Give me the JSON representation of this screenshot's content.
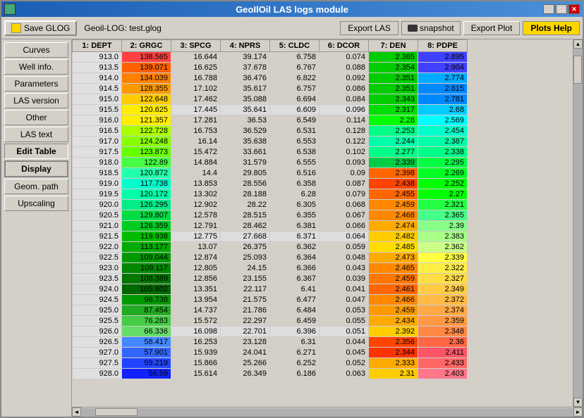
{
  "window": {
    "title": "GeoIlOil LAS logs module"
  },
  "toolbar": {
    "save_label": "Save GLOG",
    "file_label": "Geoil-LOG: test.glog",
    "export_las": "Export LAS",
    "snapshot": "snapshot",
    "export_plot": "Export Plot",
    "plots_help": "Plots Help"
  },
  "sidebar": {
    "buttons": [
      {
        "id": "curves",
        "label": "Curves"
      },
      {
        "id": "well-info",
        "label": "Well info."
      },
      {
        "id": "parameters",
        "label": "Parameters"
      },
      {
        "id": "las-version",
        "label": "LAS version"
      },
      {
        "id": "other",
        "label": "Other"
      },
      {
        "id": "las-text",
        "label": "LAS text"
      },
      {
        "id": "edit-table",
        "label": "Edit Table"
      },
      {
        "id": "display",
        "label": "Display"
      },
      {
        "id": "geom-path",
        "label": "Geom. path"
      },
      {
        "id": "upscaling",
        "label": "Upscaling"
      }
    ]
  },
  "table": {
    "columns": [
      {
        "id": "dept",
        "label": "1: DEPT"
      },
      {
        "id": "grgc",
        "label": "2: GRGC"
      },
      {
        "id": "spcg",
        "label": "3: SPCG"
      },
      {
        "id": "nprs",
        "label": "4: NPRS"
      },
      {
        "id": "cldc",
        "label": "5: CLDC"
      },
      {
        "id": "dcor",
        "label": "6: DCOR"
      },
      {
        "id": "den",
        "label": "7: DEN"
      },
      {
        "id": "pdpe",
        "label": "8: PDPE"
      }
    ],
    "rows": [
      {
        "dept": "913.0",
        "grgc": "138.565",
        "spcg": "16.644",
        "nprs": "39.174",
        "cldc": "6.758",
        "dcor": "0.074",
        "den": "2.365",
        "pdpe": "2.895",
        "grgc_color": "#ff4040",
        "den_color": "#00cc00",
        "pdpe_color": "#4040ff"
      },
      {
        "dept": "913.5",
        "grgc": "139.071",
        "spcg": "16.625",
        "nprs": "37.678",
        "cldc": "6.767",
        "dcor": "0.088",
        "den": "2.354",
        "pdpe": "2.904",
        "grgc_color": "#ff6000",
        "den_color": "#00cc00",
        "pdpe_color": "#4040ff"
      },
      {
        "dept": "914.0",
        "grgc": "134.039",
        "spcg": "16.788",
        "nprs": "36.476",
        "cldc": "6.822",
        "dcor": "0.092",
        "den": "2.351",
        "pdpe": "2.774",
        "grgc_color": "#ff8000",
        "den_color": "#00cc00",
        "pdpe_color": "#00aaff"
      },
      {
        "dept": "914.5",
        "grgc": "128.355",
        "spcg": "17.102",
        "nprs": "35.617",
        "cldc": "6.757",
        "dcor": "0.086",
        "den": "2.351",
        "pdpe": "2.815",
        "grgc_color": "#ff9900",
        "den_color": "#00cc00",
        "pdpe_color": "#0088ff"
      },
      {
        "dept": "915.0",
        "grgc": "122.648",
        "spcg": "17.462",
        "nprs": "35.088",
        "cldc": "6.694",
        "dcor": "0.084",
        "den": "2.343",
        "pdpe": "2.781",
        "grgc_color": "#ffcc00",
        "den_color": "#00cc00",
        "pdpe_color": "#0088ff"
      },
      {
        "dept": "915.5",
        "grgc": "120.625",
        "spcg": "17.445",
        "nprs": "35.641",
        "cldc": "6.609",
        "dcor": "0.096",
        "den": "2.317",
        "pdpe": "2.68",
        "grgc_color": "#ffee00",
        "den_color": "#00dd00",
        "pdpe_color": "#00ccff",
        "row_bg": "#dddddd"
      },
      {
        "dept": "916.0",
        "grgc": "121.357",
        "spcg": "17.281",
        "nprs": "36.53",
        "cldc": "6.549",
        "dcor": "0.114",
        "den": "2.28",
        "pdpe": "2.569",
        "grgc_color": "#ffee00",
        "den_color": "#00ff00",
        "pdpe_color": "#00ffff"
      },
      {
        "dept": "916.5",
        "grgc": "122.728",
        "spcg": "16.753",
        "nprs": "36.529",
        "cldc": "6.531",
        "dcor": "0.128",
        "den": "2.253",
        "pdpe": "2.454",
        "grgc_color": "#aaff00",
        "den_color": "#00ff88",
        "pdpe_color": "#00ffcc"
      },
      {
        "dept": "917.0",
        "grgc": "124.248",
        "spcg": "16.14",
        "nprs": "35.638",
        "cldc": "6.553",
        "dcor": "0.122",
        "den": "2.244",
        "pdpe": "2.387",
        "grgc_color": "#88ff00",
        "den_color": "#00ffaa",
        "pdpe_color": "#00ffaa"
      },
      {
        "dept": "917.5",
        "grgc": "123.873",
        "spcg": "15.472",
        "nprs": "33.661",
        "cldc": "6.538",
        "dcor": "0.102",
        "den": "2.277",
        "pdpe": "2.338",
        "grgc_color": "#66ff00",
        "den_color": "#00ff88",
        "pdpe_color": "#00ff88"
      },
      {
        "dept": "918.0",
        "grgc": "122.89",
        "spcg": "14.884",
        "nprs": "31.579",
        "cldc": "6.555",
        "dcor": "0.093",
        "den": "2.339",
        "pdpe": "2.295",
        "grgc_color": "#44ff44",
        "den_color": "#00cc44",
        "pdpe_color": "#00ff44"
      },
      {
        "dept": "918.5",
        "grgc": "120.872",
        "spcg": "14.4",
        "nprs": "29.805",
        "cldc": "6.516",
        "dcor": "0.09",
        "den": "2.398",
        "pdpe": "2.269",
        "grgc_color": "#22ffaa",
        "den_color": "#ff6600",
        "pdpe_color": "#00ff22"
      },
      {
        "dept": "919.0",
        "grgc": "117.738",
        "spcg": "13.853",
        "nprs": "28.556",
        "cldc": "6.358",
        "dcor": "0.087",
        "den": "2.438",
        "pdpe": "2.252",
        "grgc_color": "#00ffcc",
        "den_color": "#ff4400",
        "pdpe_color": "#00ff00"
      },
      {
        "dept": "919.5",
        "grgc": "120.172",
        "spcg": "13.302",
        "nprs": "28.188",
        "cldc": "6.28",
        "dcor": "0.079",
        "den": "2.455",
        "pdpe": "2.27",
        "grgc_color": "#00ffaa",
        "den_color": "#ff6600",
        "pdpe_color": "#00ff00"
      },
      {
        "dept": "920.0",
        "grgc": "126.295",
        "spcg": "12.902",
        "nprs": "28.22",
        "cldc": "6.305",
        "dcor": "0.068",
        "den": "2.459",
        "pdpe": "2.321",
        "grgc_color": "#00ee88",
        "den_color": "#ff8800",
        "pdpe_color": "#22ff44"
      },
      {
        "dept": "920.5",
        "grgc": "129.807",
        "spcg": "12.578",
        "nprs": "28.515",
        "cldc": "6.355",
        "dcor": "0.067",
        "den": "2.468",
        "pdpe": "2.365",
        "grgc_color": "#00dd44",
        "den_color": "#ff8800",
        "pdpe_color": "#44ff88"
      },
      {
        "dept": "921.0",
        "grgc": "126.359",
        "spcg": "12.791",
        "nprs": "28.462",
        "cldc": "6.381",
        "dcor": "0.066",
        "den": "2.474",
        "pdpe": "2.39",
        "grgc_color": "#00cc22",
        "den_color": "#ffaa00",
        "pdpe_color": "#88ff88"
      },
      {
        "dept": "921.5",
        "grgc": "119.938",
        "spcg": "12.775",
        "nprs": "27.668",
        "cldc": "6.371",
        "dcor": "0.064",
        "den": "2.482",
        "pdpe": "2.383",
        "grgc_color": "#00bb00",
        "den_color": "#ffcc00",
        "pdpe_color": "#aaff88",
        "row_bg": "#dddddd"
      },
      {
        "dept": "922.0",
        "grgc": "113.177",
        "spcg": "13.07",
        "nprs": "26.375",
        "cldc": "6.362",
        "dcor": "0.059",
        "den": "2.485",
        "pdpe": "2.362",
        "grgc_color": "#00aa00",
        "den_color": "#ffdd00",
        "pdpe_color": "#ccff88"
      },
      {
        "dept": "922.5",
        "grgc": "109.044",
        "spcg": "12.874",
        "nprs": "25.093",
        "cldc": "6.364",
        "dcor": "0.048",
        "den": "2.473",
        "pdpe": "2.339",
        "grgc_color": "#009900",
        "den_color": "#ffaa00",
        "pdpe_color": "#ffff44"
      },
      {
        "dept": "923.0",
        "grgc": "109.117",
        "spcg": "12.805",
        "nprs": "24.15",
        "cldc": "6.366",
        "dcor": "0.043",
        "den": "2.465",
        "pdpe": "2.322",
        "grgc_color": "#008800",
        "den_color": "#ff8800",
        "pdpe_color": "#ffee44"
      },
      {
        "dept": "923.5",
        "grgc": "108.389",
        "spcg": "12.856",
        "nprs": "23.155",
        "cldc": "6.367",
        "dcor": "0.039",
        "den": "2.459",
        "pdpe": "2.327",
        "grgc_color": "#007700",
        "den_color": "#ff7700",
        "pdpe_color": "#ffdd44"
      },
      {
        "dept": "924.0",
        "grgc": "105.802",
        "spcg": "13.351",
        "nprs": "22.117",
        "cldc": "6.41",
        "dcor": "0.041",
        "den": "2.461",
        "pdpe": "2.349",
        "grgc_color": "#006600",
        "den_color": "#ff6600",
        "pdpe_color": "#ffcc44"
      },
      {
        "dept": "924.5",
        "grgc": "98.738",
        "spcg": "13.954",
        "nprs": "21.575",
        "cldc": "6.477",
        "dcor": "0.047",
        "den": "2.466",
        "pdpe": "2.372",
        "grgc_color": "#009900",
        "den_color": "#ff8800",
        "pdpe_color": "#ffbb44"
      },
      {
        "dept": "925.0",
        "grgc": "87.454",
        "spcg": "14.737",
        "nprs": "21.786",
        "cldc": "6.484",
        "dcor": "0.053",
        "den": "2.459",
        "pdpe": "2.374",
        "grgc_color": "#22aa22",
        "den_color": "#ff9900",
        "pdpe_color": "#ffaa44"
      },
      {
        "dept": "925.5",
        "grgc": "76.283",
        "spcg": "15.572",
        "nprs": "22.297",
        "cldc": "6.459",
        "dcor": "0.055",
        "den": "2.434",
        "pdpe": "2.359",
        "grgc_color": "#44cc44",
        "den_color": "#ffaa00",
        "pdpe_color": "#ff9944"
      },
      {
        "dept": "926.0",
        "grgc": "66.336",
        "spcg": "16.098",
        "nprs": "22.701",
        "cldc": "6.396",
        "dcor": "0.051",
        "den": "2.392",
        "pdpe": "2.348",
        "grgc_color": "#66dd66",
        "den_color": "#ffcc00",
        "pdpe_color": "#ff8844",
        "row_bg": "#dddddd"
      },
      {
        "dept": "926.5",
        "grgc": "58.417",
        "spcg": "16.253",
        "nprs": "23.128",
        "cldc": "6.31",
        "dcor": "0.044",
        "den": "2.356",
        "pdpe": "2.36",
        "grgc_color": "#4488ff",
        "den_color": "#ff4400",
        "pdpe_color": "#ff6644"
      },
      {
        "dept": "927.0",
        "grgc": "57.901",
        "spcg": "15.939",
        "nprs": "24.041",
        "cldc": "6.271",
        "dcor": "0.045",
        "den": "2.344",
        "pdpe": "2.411",
        "grgc_color": "#3366ff",
        "den_color": "#ff3300",
        "pdpe_color": "#ff5566"
      },
      {
        "dept": "927.5",
        "grgc": "59.219",
        "spcg": "15.866",
        "nprs": "25.266",
        "cldc": "6.252",
        "dcor": "0.052",
        "den": "2.333",
        "pdpe": "2.433",
        "grgc_color": "#2244ff",
        "den_color": "#ffaa00",
        "pdpe_color": "#ff6666"
      },
      {
        "dept": "928.0",
        "grgc": "56.59",
        "spcg": "15.614",
        "nprs": "26.349",
        "cldc": "6.186",
        "dcor": "0.063",
        "den": "2.31",
        "pdpe": "2.403",
        "grgc_color": "#1122ff",
        "den_color": "#ffcc00",
        "pdpe_color": "#ff7788"
      }
    ]
  }
}
